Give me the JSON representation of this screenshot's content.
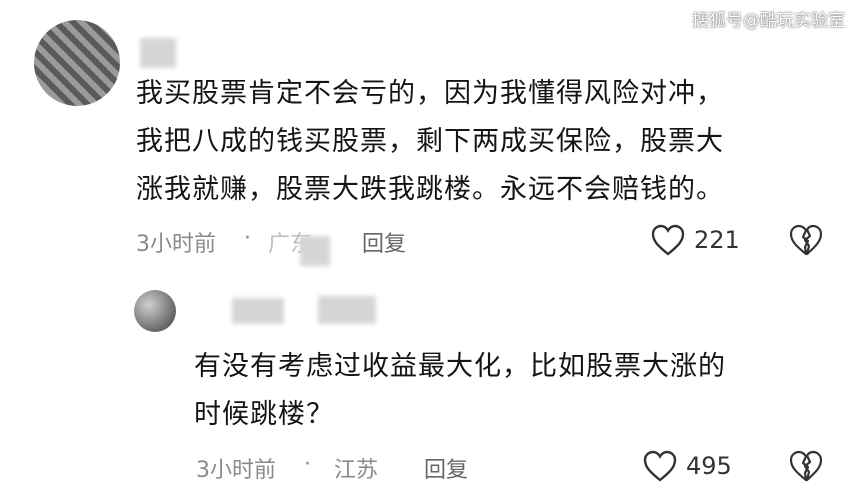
{
  "watermark": "搜狐号@酷玩实验室",
  "comments": [
    {
      "lines": [
        "我买股票肯定不会亏的，因为我懂得风险对冲，",
        "我把八成的钱买股票，剩下两成买保险，股票大",
        "涨我就赚，股票大跌我跳楼。永远不会赔钱的。"
      ],
      "time": "3小时前",
      "location": "广东",
      "reply_label": "回复",
      "likes": "221",
      "like_icon": "heart-outline-icon",
      "dislike_icon": "broken-heart-icon"
    },
    {
      "lines": [
        "有没有考虑过收益最大化，比如股票大涨的",
        "时候跳楼？"
      ],
      "time": "3小时前",
      "location": "江苏",
      "reply_label": "回复",
      "likes": "495",
      "like_icon": "heart-outline-icon",
      "dislike_icon": "broken-heart-icon"
    }
  ]
}
